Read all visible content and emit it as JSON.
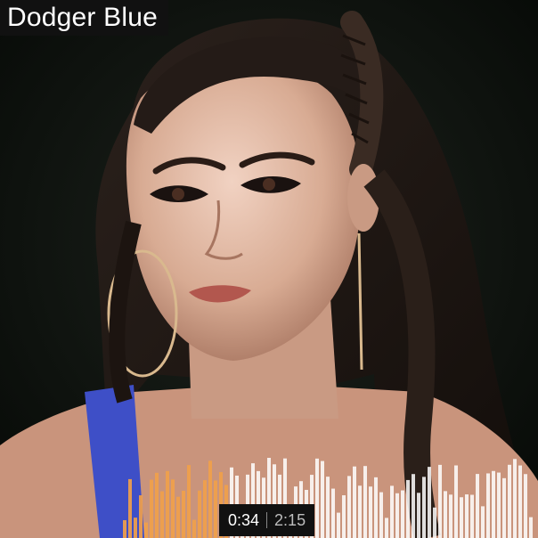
{
  "track": {
    "title": "Dodger Blue"
  },
  "player": {
    "current_time": "0:34",
    "duration": "2:15",
    "progress": 0.251,
    "played_color": "#f0a04a",
    "unplayed_color": "#ffffff"
  },
  "colors": {
    "background": "#0a0f0b",
    "shirt": "#3e4fc7",
    "title_bar": "#111111"
  }
}
